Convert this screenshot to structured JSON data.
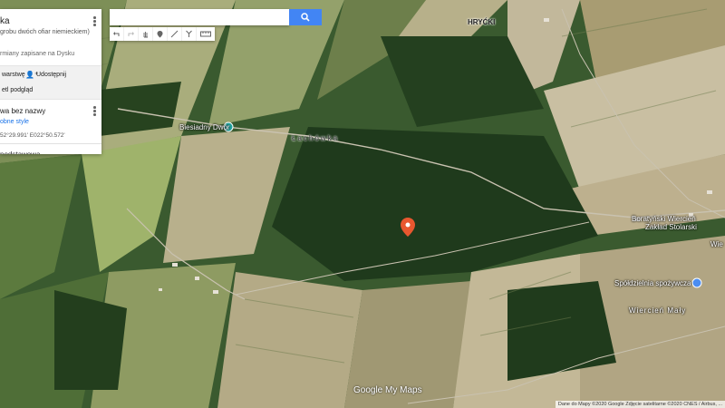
{
  "panel": {
    "title": "ka",
    "subtitle": "grobu dwóch ofiar niemieckiem)",
    "saved_status": "rmiany zapisane na Dysku",
    "add_layer_label": "warstwę",
    "share_label": "Udostępnij",
    "preview_label": "etl podgląd",
    "layer_name": "wa bez nazwy",
    "styles_link": "obne style",
    "coordinates": "52°29.991' E022°50.572'",
    "base_map_label": "podstawowa"
  },
  "search": {
    "value": "",
    "placeholder": ""
  },
  "toolbar": {
    "icons": [
      "undo-icon",
      "redo-icon",
      "hand-icon",
      "marker-icon",
      "line-icon",
      "directions-icon",
      "ruler-icon"
    ]
  },
  "map_labels": {
    "hrycki": "HRYĆKI",
    "biesiadny": "Biesiadny Dwór",
    "lachowka": "Łachówka",
    "boratynski": "Boratyński Wiercień",
    "zaklad": "Zakład Stolarski",
    "wie": "Wie",
    "spoldzielnia": "Spółdzielnia spożywcza",
    "wiercien_maly": "Wiercień Mały"
  },
  "footer": {
    "logo": "Google My Maps",
    "attribution": "Dane do Mapy ©2020 Google Zdjęcie satelitarne ©2020 CNES / Airbus, ..."
  },
  "colors": {
    "accent": "#4285f4",
    "marker": "#e8572f",
    "poi_teal": "#24a6a1",
    "poi_blue": "#4b8df0"
  }
}
